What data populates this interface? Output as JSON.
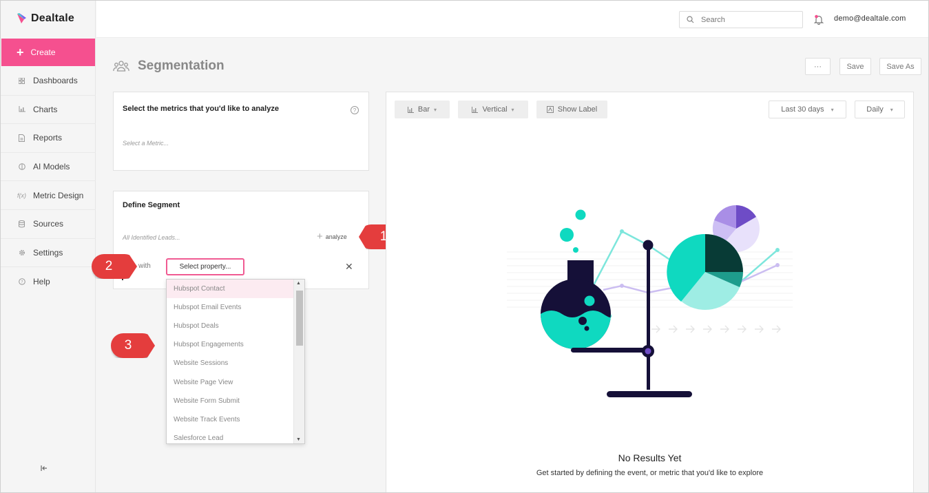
{
  "app": {
    "name": "Dealtale"
  },
  "sidebar": {
    "create_label": "Create",
    "items": [
      {
        "label": "Dashboards",
        "icon": "grid-icon"
      },
      {
        "label": "Charts",
        "icon": "bar-chart-icon"
      },
      {
        "label": "Reports",
        "icon": "document-icon"
      },
      {
        "label": "AI Models",
        "icon": "ai-icon"
      },
      {
        "label": "Metric Design",
        "icon": "function-icon"
      },
      {
        "label": "Sources",
        "icon": "database-icon"
      },
      {
        "label": "Settings",
        "icon": "gear-icon"
      },
      {
        "label": "Help",
        "icon": "help-icon"
      }
    ]
  },
  "topbar": {
    "search_placeholder": "Search",
    "user_email": "demo@dealtale.com"
  },
  "page": {
    "title": "Segmentation",
    "more_label": "···",
    "save_label": "Save",
    "save_as_label": "Save As"
  },
  "metrics_card": {
    "title": "Select the metrics that you'd like to analyze",
    "placeholder": "Select a Metric..."
  },
  "segment_card": {
    "title": "Define Segment",
    "leads_placeholder": "All Identified Leads...",
    "analyze_label": "analyze",
    "with_label": "with",
    "select_property_label": "Select property..."
  },
  "dropdown": {
    "items": [
      "Hubspot Contact",
      "Hubspot Email Events",
      "Hubspot Deals",
      "Hubspot Engagements",
      "Website Sessions",
      "Website Page View",
      "Website Form Submit",
      "Website Track Events",
      "Salesforce Lead"
    ]
  },
  "callouts": [
    "1",
    "2",
    "3"
  ],
  "chart_toolbar": {
    "type_label": "Bar",
    "orientation_label": "Vertical",
    "show_label": "Show Label",
    "range_label": "Last 30 days",
    "interval_label": "Daily"
  },
  "empty_state": {
    "title": "No Results Yet",
    "subtitle": "Get started by defining the event, or metric that you'd like to explore"
  },
  "colors": {
    "brand_pink": "#f5508f",
    "teal": "#0fd9c0",
    "navy": "#151038",
    "purple": "#6e4cc6",
    "callout_red": "#e43d3d"
  }
}
